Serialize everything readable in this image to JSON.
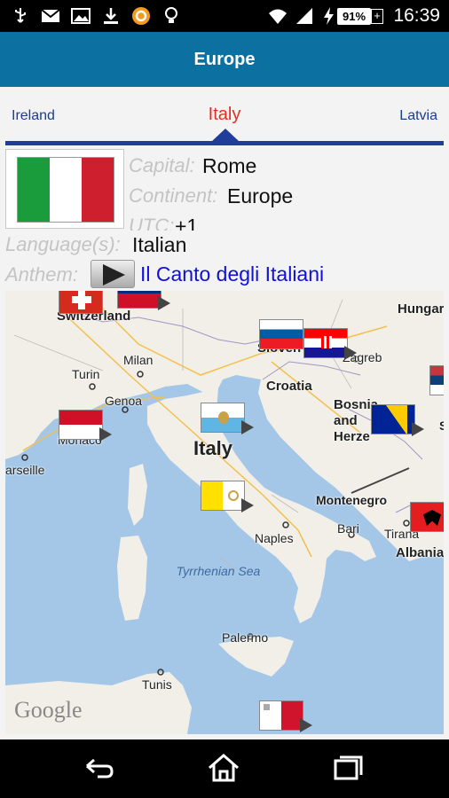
{
  "status_bar": {
    "battery": "91%",
    "battery_plus": "+",
    "time": "16:39"
  },
  "action_bar": {
    "title": "Europe"
  },
  "tabs": {
    "previous": "Ireland",
    "current": "Italy",
    "next": "Latvia"
  },
  "country": {
    "capital_label": "Capital:",
    "capital": "Rome",
    "continent_label": "Continent:",
    "continent": "Europe",
    "utc_label": "UTC:",
    "utc": "+1",
    "language_label": "Language(s):",
    "language": "Italian",
    "anthem_label": "Anthem:",
    "anthem": "Il Canto degli Italiani",
    "flag_colors": [
      "#1a9b3c",
      "#ffffff",
      "#cd1f2d"
    ]
  },
  "map": {
    "countries": {
      "switzerland": "Switzerland",
      "hungary": "Hungar",
      "slovenia": "Sloven",
      "croatia": "Croatia",
      "bosnia": "Bosnia and Herze",
      "italy": "Italy",
      "montenegro": "Montenegro",
      "albania": "Albania",
      "monaco": "Monaco"
    },
    "cities": {
      "milan": "Milan",
      "turin": "Turin",
      "genoa": "Genoa",
      "zagreb": "Zagreb",
      "marseille": "arseille",
      "naples": "Naples",
      "bari": "Bari",
      "tirana": "Tirana",
      "palermo": "Palermo",
      "tunis": "Tunis"
    },
    "sea": "Tyrrhenian Sea",
    "s_partial": "S",
    "attribution": "Google",
    "land_color": "#f1efe8",
    "sea_color": "#a4c7e8"
  }
}
